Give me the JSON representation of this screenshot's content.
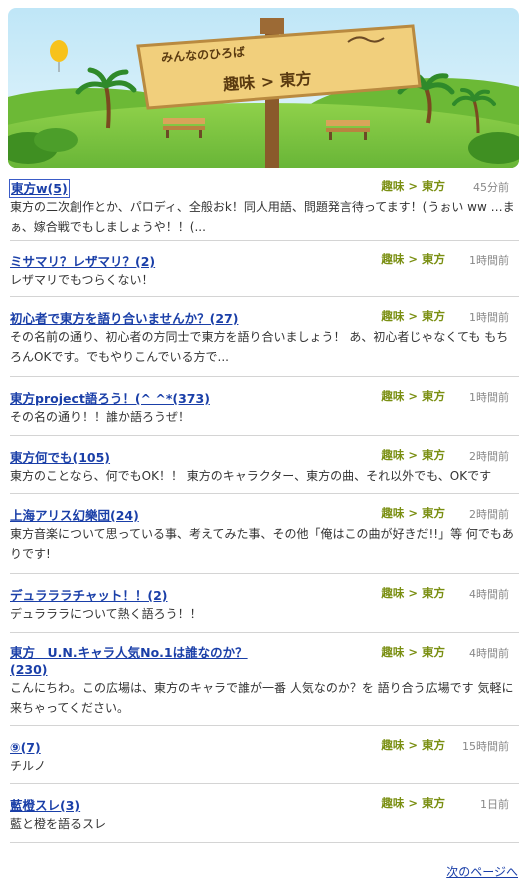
{
  "banner": {
    "line1": "みんなのひろば",
    "line2": "趣味 > 東方"
  },
  "topics": [
    {
      "title": "東方w(5)",
      "category": "趣味 > 東方",
      "time": "45分前",
      "desc": "東方の二次創作とか、パロディ、全般おk！同人用語、問題発言待ってます！(うぉい ww …まぁ、嫁合戦でもしましょうや！！(..."
    },
    {
      "title": "ミサマリ？レザマリ？(2)",
      "category": "趣味 > 東方",
      "time": "1時間前",
      "desc": "レザマリでもつらくない！"
    },
    {
      "title": "初心者で東方を語り合いませんか？(27)",
      "category": "趣味 > 東方",
      "time": "1時間前",
      "desc": "その名前の通り、初心者の方同士で東方を語り合いましょう！ あ、初心者じゃなくても もちろんOKです。でもやりこんでいる方で..."
    },
    {
      "title": "東方project語ろう！(^ ^*(373)",
      "category": "趣味 > 東方",
      "time": "1時間前",
      "desc": "その名の通り！！誰か語ろうぜ！"
    },
    {
      "title": "東方何でも(105)",
      "category": "趣味 > 東方",
      "time": "2時間前",
      "desc": "東方のことなら、何でもOK！！ 東方のキャラクター、東方の曲、それ以外でも、OKです"
    },
    {
      "title": "上海アリス幻樂団(24)",
      "category": "趣味 > 東方",
      "time": "2時間前",
      "desc": "東方音楽について思っている事、考えてみた事、その他「俺はこの曲が好きだ!!」等 何でもありです!"
    },
    {
      "title": "デュラララチャット！！(2)",
      "category": "趣味 > 東方",
      "time": "4時間前",
      "desc": "デュラララについて熱く語ろう！！"
    },
    {
      "title": "東方　U.N.キャラ人気No.1は誰なのか？(230)",
      "category": "趣味 > 東方",
      "time": "4時間前",
      "desc": "こんにちわ。この広場は、東方のキャラで誰が一番 人気なのか？を 語り合う広場です 気軽に来ちゃってください。"
    },
    {
      "title": "⑨(7)",
      "category": "趣味 > 東方",
      "time": "15時間前",
      "desc": "チルノ"
    },
    {
      "title": "藍橙スレ(3)",
      "category": "趣味 > 東方",
      "time": "1日前",
      "desc": "藍と橙を語るスレ"
    }
  ],
  "pagination": {
    "next_label": "次のページへ"
  }
}
